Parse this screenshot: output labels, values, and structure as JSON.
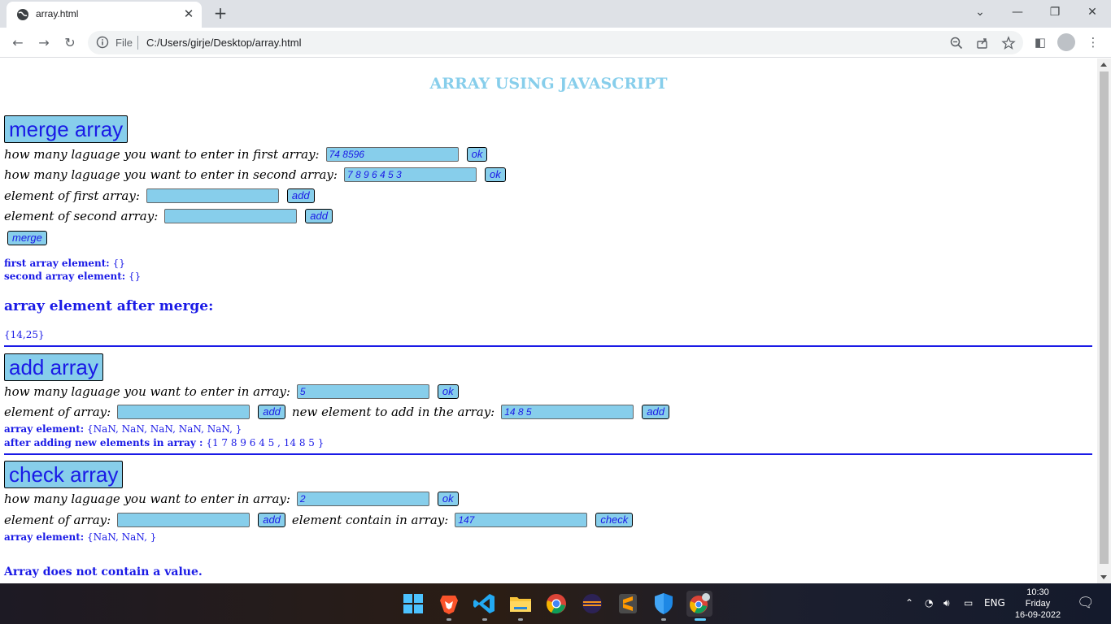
{
  "browser": {
    "tab_title": "array.html",
    "omnibox_scheme_label": "File",
    "omnibox_url": "C:/Users/girje/Desktop/array.html"
  },
  "page": {
    "title": "ARRAY USING JAVASCRIPT",
    "merge": {
      "heading": "merge array",
      "first_count_label": "how many laguage you want to enter in first array:",
      "first_count_value": "74 8596",
      "second_count_label": "how many laguage you want to enter in second array:",
      "second_count_value": "7 8 9 6 4 5 3",
      "first_elem_label": "element of first array:",
      "first_elem_value": "",
      "second_elem_label": "element of second array:",
      "second_elem_value": "",
      "ok_label": "ok",
      "add_label": "add",
      "merge_label": "merge",
      "first_array_label": "first array element:",
      "first_array_value": "{}",
      "second_array_label": "second array element:",
      "second_array_value": "{}",
      "after_merge_label": "array element after merge:",
      "after_merge_value": "{14,25}"
    },
    "add": {
      "heading": "add array",
      "count_label": "how many laguage you want to enter in array:",
      "count_value": "5",
      "elem_label": "element of array:",
      "elem_value": "",
      "new_elem_label": "new element to add in the array:",
      "new_elem_value": "14 8 5",
      "ok_label": "ok",
      "add_label": "add",
      "array_label": "array element:",
      "array_value": "{NaN, NaN, NaN, NaN, NaN, }",
      "after_add_label": "after adding new elements in array :",
      "after_add_value": "{1 7 8 9 6 4 5 , 14 8 5 }"
    },
    "check": {
      "heading": "check array",
      "count_label": "how many laguage you want to enter in array:",
      "count_value": "2",
      "elem_label": "element of array:",
      "elem_value": "",
      "contain_label": "element contain in array:",
      "contain_value": "147",
      "ok_label": "ok",
      "add_label": "add",
      "check_label": "check",
      "array_label": "array element:",
      "array_value": "{NaN, NaN, }",
      "result": "Array does not contain a value."
    }
  },
  "taskbar": {
    "apps": [
      "windows-start-icon",
      "brave-icon",
      "vscode-icon",
      "file-explorer-icon",
      "chrome-icon",
      "eclipse-icon",
      "sublime-text-icon",
      "defender-icon",
      "chrome-profile-icon"
    ],
    "language": "ENG",
    "time": "10:30",
    "day": "Friday",
    "date": "16-09-2022"
  },
  "colors": {
    "accent_blue": "#1a1ae6",
    "sky_blue": "#87ceeb"
  }
}
